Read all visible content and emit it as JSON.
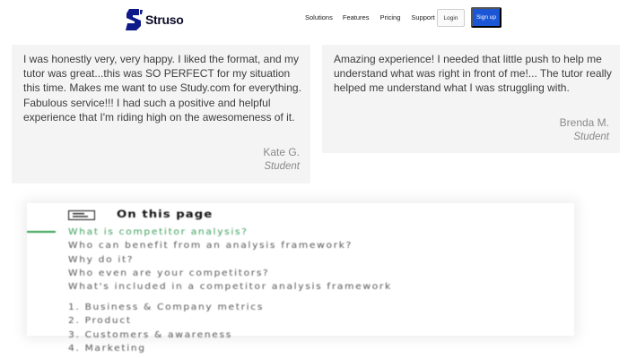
{
  "brand": {
    "name": "Struso",
    "color": "#0f1a8a"
  },
  "nav": {
    "links": [
      "Solutions",
      "Features",
      "Pricing",
      "Support"
    ],
    "login_label": "Login",
    "signup_label": "Sign up",
    "accent": "#1a56d6"
  },
  "testimonials": [
    {
      "quote": "I was honestly very, very happy. I liked the format, and my tutor was great...this was SO PERFECT for my situation this time. Makes me want to use Study.com for everything. Fabulous service!!! I had such a positive and helpful experience that I'm riding high on the awesomeness of it.",
      "author": "Kate G.",
      "role": "Student"
    },
    {
      "quote": "Amazing experience! I needed that little push to help me understand what was right in front of me!... The tutor really helped me understand what I was struggling with.",
      "author": "Brenda M.",
      "role": "Student"
    }
  ],
  "toc": {
    "icon": "list-icon",
    "heading": "On this page",
    "active_color": "#3aa05a",
    "items": [
      "What is competitor analysis?",
      "Who can benefit from an analysis framework?",
      "Why do it?",
      "Who even are your competitors?",
      "What's included in a competitor analysis framework",
      "1. Business & Company metrics",
      "2. Product",
      "3. Customers & awareness",
      "4. Marketing"
    ]
  }
}
